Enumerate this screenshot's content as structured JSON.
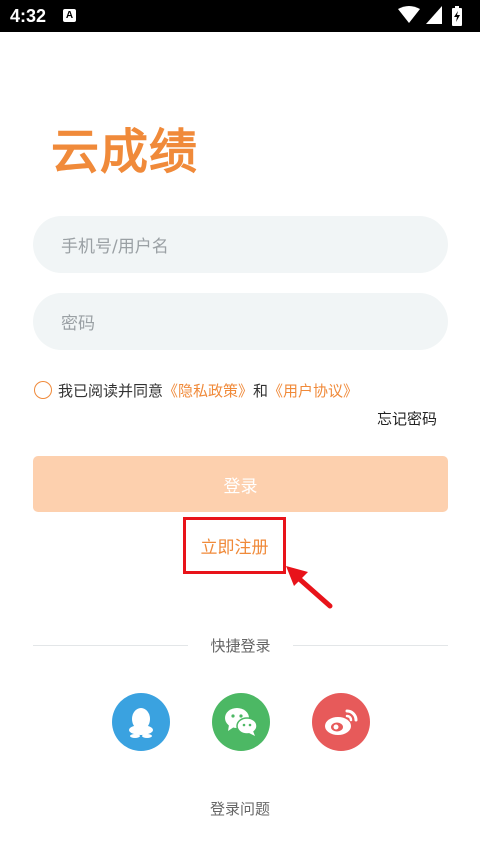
{
  "status_bar": {
    "time": "4:32",
    "notification_icon_letter": "A",
    "icons": [
      "wifi-icon",
      "cell-signal-icon",
      "battery-charging-icon"
    ]
  },
  "app": {
    "logo_text": "云成绩",
    "brand_color": "#f08a3a"
  },
  "login_form": {
    "phone_placeholder": "手机号/用户名",
    "password_placeholder": "密码",
    "agree_prefix": "我已阅读并同意",
    "privacy_policy": "《隐私政策》",
    "agree_and": "和",
    "user_agreement": "《用户协议》",
    "forgot_password": "忘记密码",
    "login_button": "登录",
    "register_link": "立即注册"
  },
  "quick_login": {
    "label": "快捷登录",
    "providers": [
      {
        "name": "qq",
        "icon": "qq-icon",
        "color": "#3aa2e0"
      },
      {
        "name": "wechat",
        "icon": "wechat-icon",
        "color": "#4cb864"
      },
      {
        "name": "weibo",
        "icon": "weibo-icon",
        "color": "#e75a5a"
      }
    ]
  },
  "footer": {
    "help_text": "登录问题"
  },
  "annotation": {
    "highlight_color": "#e8131a"
  }
}
